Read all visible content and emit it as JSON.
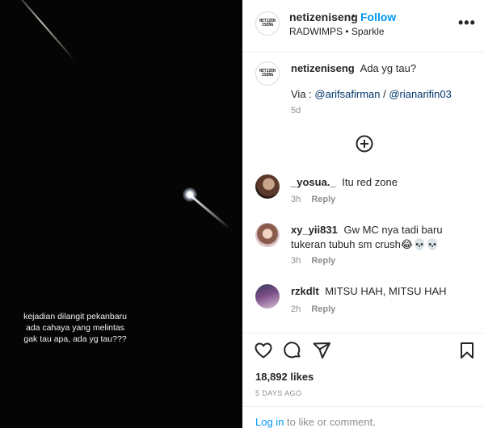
{
  "media": {
    "caption_lines": [
      "kejadian dilangit pekanbaru",
      "ada cahaya yang melintas",
      "gak tau apa, ada yg tau???"
    ]
  },
  "header": {
    "username": "netizeniseng",
    "separator": "•",
    "follow_label": "Follow",
    "music": "RADWIMPS • Sparkle",
    "more_label": "•••",
    "logo_text": "NETIZEN ISENG"
  },
  "post": {
    "username": "netizeniseng",
    "text": "Ada yg tau?",
    "via_label": "Via : ",
    "mention1": "@arifsafirman",
    "mention_sep": " / ",
    "mention2": "@rianarifin03",
    "age": "5d"
  },
  "comments": [
    {
      "username": "_yosua._",
      "text": "Itu red zone",
      "age": "3h",
      "reply": "Reply"
    },
    {
      "username": "xy_yii831",
      "text": "Gw MC nya tadi baru tukeran tubuh sm crush😂💀💀",
      "age": "3h",
      "reply": "Reply"
    },
    {
      "username": "rzkdlt",
      "text": "MITSU HAH, MITSU HAH",
      "age": "2h",
      "reply": "Reply"
    }
  ],
  "stats": {
    "likes": "18,892 likes",
    "date": "5 DAYS AGO"
  },
  "login": {
    "link": "Log in",
    "rest": " to like or comment."
  },
  "icons": [
    "heart-icon",
    "comment-icon",
    "share-icon",
    "bookmark-icon",
    "add-circle-icon",
    "more-icon"
  ]
}
